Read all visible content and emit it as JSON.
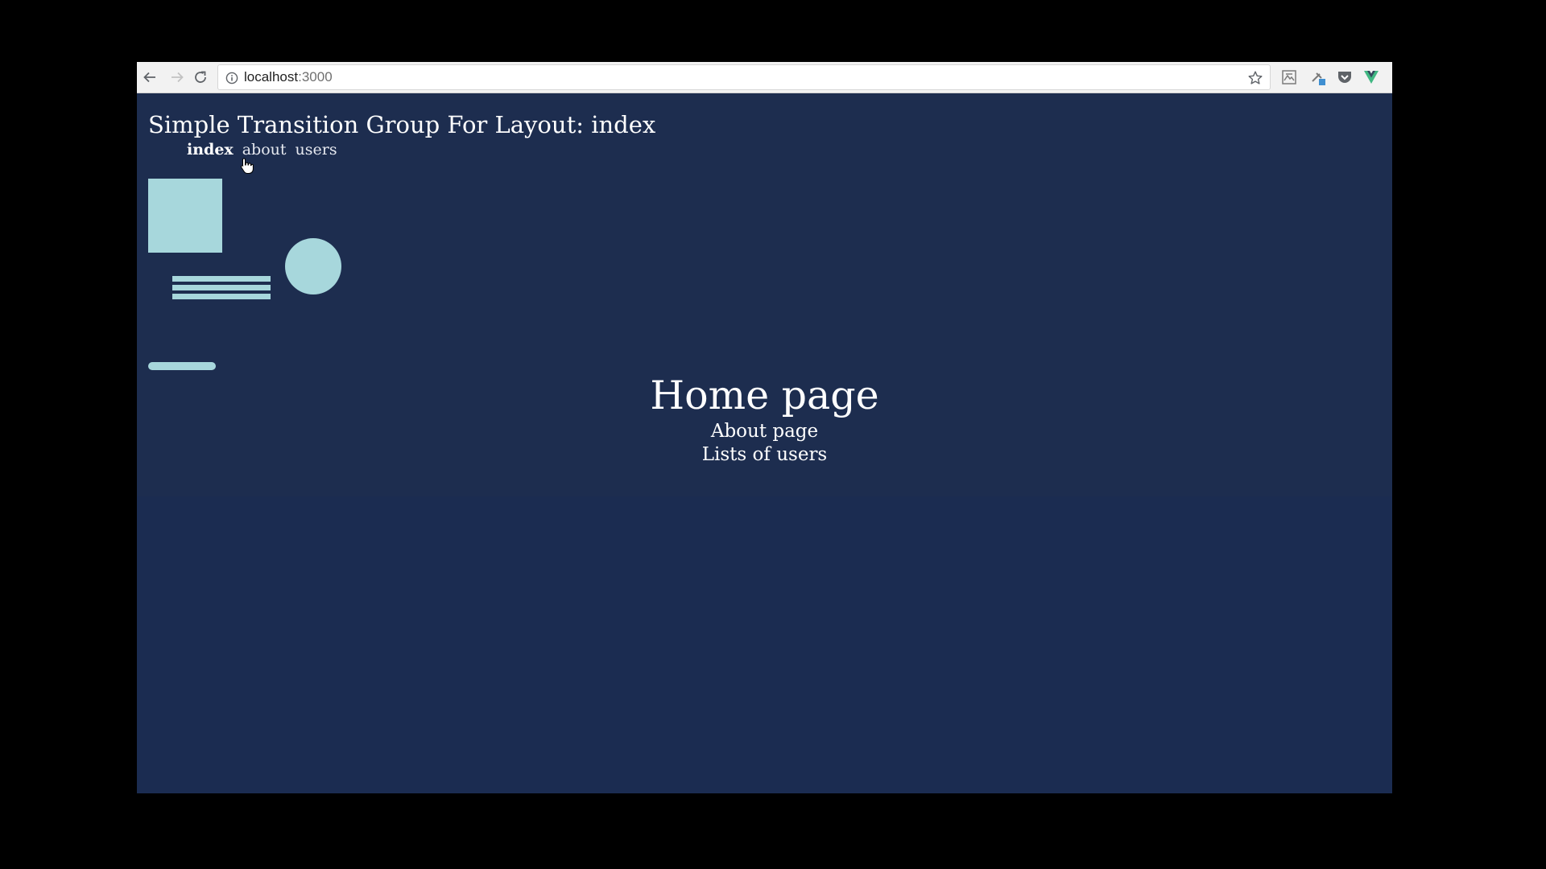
{
  "browser": {
    "url_host": "localhost",
    "url_port": ":3000",
    "icons": {
      "back": "arrow-left-icon",
      "forward": "arrow-right-icon",
      "reload": "reload-icon",
      "info": "info-icon",
      "bookmark": "star-icon",
      "extensions": [
        "extension-icon-1",
        "extension-icon-2",
        "pocket-icon",
        "vue-devtools-icon"
      ]
    }
  },
  "page": {
    "title": "Simple Transition Group For Layout: index",
    "nav": {
      "index": "index",
      "about": "about",
      "users": "users",
      "active": "index"
    },
    "heading": "Home page",
    "links": {
      "about": "About page",
      "users": "Lists of users"
    }
  },
  "colors": {
    "page_background": "#1d2d4f",
    "shape_fill": "#a7d7dc",
    "text": "#ffffff",
    "vue_accent": "#41b883"
  }
}
